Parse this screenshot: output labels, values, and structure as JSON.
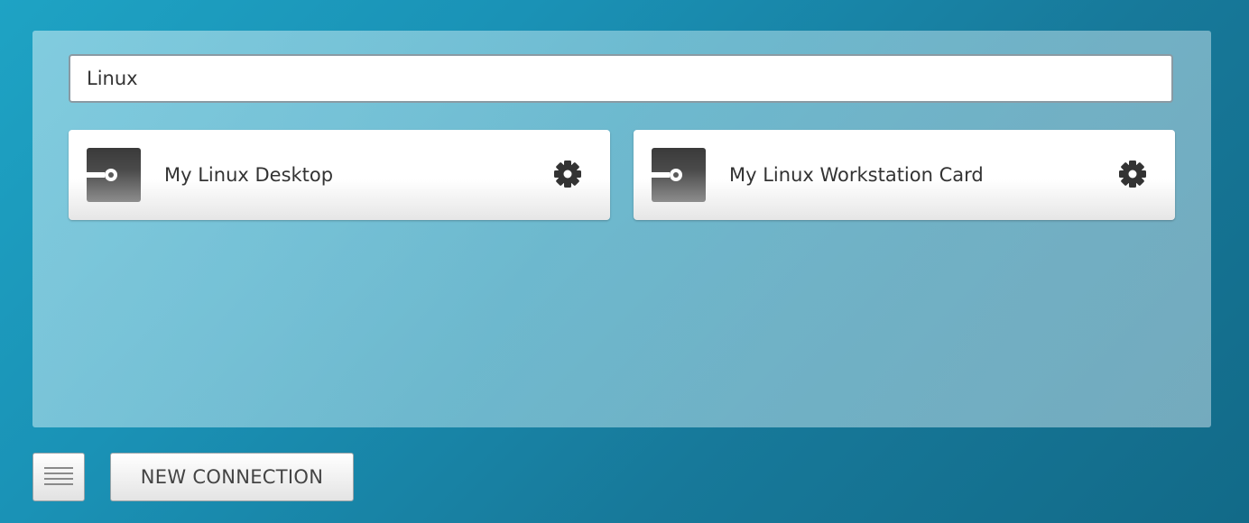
{
  "search": {
    "value": "Linux",
    "placeholder": ""
  },
  "connections": [
    {
      "label": "My Linux Desktop",
      "thumbnail_icon": "connection-icon",
      "settings_icon": "gear-icon"
    },
    {
      "label": "My Linux Workstation Card",
      "thumbnail_icon": "connection-icon",
      "settings_icon": "gear-icon"
    }
  ],
  "footer": {
    "menu_icon": "hamburger-icon",
    "new_connection_label": "NEW CONNECTION"
  },
  "colors": {
    "background": "#1a92b6",
    "panel": "#a8d8e4",
    "card": "#ffffff",
    "icon_dark": "#333333"
  }
}
